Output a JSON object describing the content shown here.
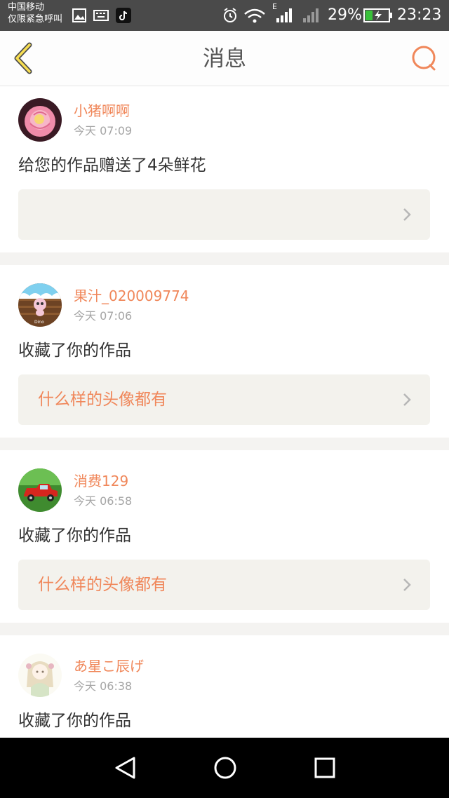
{
  "status_bar": {
    "carrier_line1": "中国移动",
    "carrier_line2": "仅限紧急呼叫",
    "battery_text": "29%",
    "time": "23:23",
    "network_type": "E",
    "icons": [
      "image-icon",
      "keyboard-icon",
      "tiktok-icon",
      "alarm-icon",
      "wifi-icon",
      "signal-icon",
      "battery-icon"
    ]
  },
  "header": {
    "title": "消息",
    "back_icon": "chevron-left-icon",
    "search_icon": "search-icon",
    "accent": "#f0875a"
  },
  "messages": [
    {
      "username": "小猪啊啊",
      "time": "今天 07:09",
      "action": "给您的作品赠送了4朵鲜花",
      "work_title": "",
      "avatar": "rose-avatar"
    },
    {
      "username": "果汁_020009774",
      "time": "今天 07:06",
      "action": "收藏了你的作品",
      "work_title": "什么样的头像都有",
      "avatar": "cartoon-avatar",
      "avatar_caption": "Dino"
    },
    {
      "username": "消费129",
      "time": "今天 06:58",
      "action": "收藏了你的作品",
      "work_title": "什么样的头像都有",
      "avatar": "red-car-avatar"
    },
    {
      "username": "あ星こ辰げ",
      "time": "今天 06:38",
      "action": "收藏了你的作品",
      "avatar": "anime-girl-avatar"
    }
  ],
  "nav_bar": {
    "buttons": [
      "back-triangle-icon",
      "home-circle-icon",
      "recents-square-icon"
    ]
  }
}
